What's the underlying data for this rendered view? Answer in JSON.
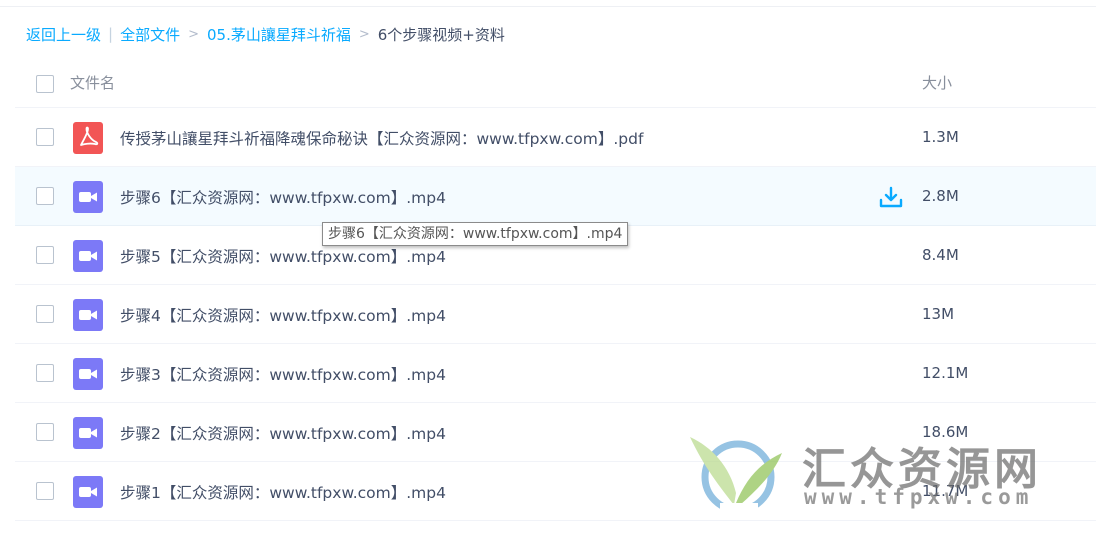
{
  "breadcrumb": {
    "back": "返回上一级",
    "all_files": "全部文件",
    "folder": "05.茅山讓星拜斗祈福",
    "current": "6个步骤视频+资料",
    "separator": ">",
    "bar": "|"
  },
  "table": {
    "col_name": "文件名",
    "col_size": "大小"
  },
  "files": [
    {
      "name": "传授茅山讓星拜斗祈福降魂保命秘诀【汇众资源网：www.tfpxw.com】.pdf",
      "size": "1.3M",
      "type": "pdf-icon"
    },
    {
      "name": "步骤6【汇众资源网：www.tfpxw.com】.mp4",
      "size": "2.8M",
      "type": "video-icon"
    },
    {
      "name": "步骤5【汇众资源网：www.tfpxw.com】.mp4",
      "size": "8.4M",
      "type": "video-icon"
    },
    {
      "name": "步骤4【汇众资源网：www.tfpxw.com】.mp4",
      "size": "13M",
      "type": "video-icon"
    },
    {
      "name": "步骤3【汇众资源网：www.tfpxw.com】.mp4",
      "size": "12.1M",
      "type": "video-icon"
    },
    {
      "name": "步骤2【汇众资源网：www.tfpxw.com】.mp4",
      "size": "18.6M",
      "type": "video-icon"
    },
    {
      "name": "步骤1【汇众资源网：www.tfpxw.com】.mp4",
      "size": "11.7M",
      "type": "video-icon"
    }
  ],
  "tooltip": {
    "text": "步骤6【汇众资源网：www.tfpxw.com】.mp4"
  },
  "watermark": {
    "title": "汇众资源网",
    "url": "www.tfpxw.com"
  },
  "colors": {
    "link": "#09aaff",
    "pdf": "#f25555",
    "video": "#7c79f7",
    "hover_row": "#f4fbff"
  }
}
